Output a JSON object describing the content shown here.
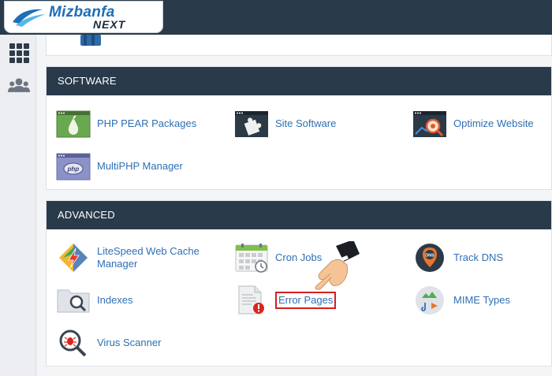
{
  "brand": {
    "name": "Mizbanfa",
    "tagline": "NEXT"
  },
  "sections": {
    "software": {
      "title": "SOFTWARE",
      "items": [
        {
          "label": "PHP PEAR Packages",
          "icon": "php-pear-icon"
        },
        {
          "label": "Site Software",
          "icon": "puzzle-icon"
        },
        {
          "label": "Optimize Website",
          "icon": "magnifier-gear-icon"
        },
        {
          "label": "MultiPHP Manager",
          "icon": "php-icon"
        }
      ]
    },
    "advanced": {
      "title": "ADVANCED",
      "items": [
        {
          "label": "LiteSpeed Web Cache Manager",
          "icon": "litespeed-icon"
        },
        {
          "label": "Cron Jobs",
          "icon": "calendar-icon"
        },
        {
          "label": "Track DNS",
          "icon": "dns-pin-icon"
        },
        {
          "label": "Indexes",
          "icon": "folder-search-icon"
        },
        {
          "label": "Error Pages",
          "icon": "error-document-icon"
        },
        {
          "label": "MIME Types",
          "icon": "media-icon"
        },
        {
          "label": "Virus Scanner",
          "icon": "virus-scan-icon"
        }
      ]
    }
  },
  "colors": {
    "header": "#293a4a",
    "link": "#2f6fb3",
    "highlight": "#d71e1e"
  }
}
